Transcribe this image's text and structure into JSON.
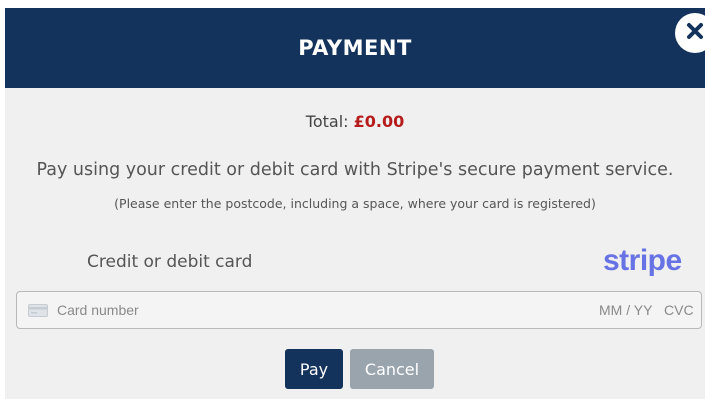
{
  "header": {
    "title": "PAYMENT",
    "close_icon": "close-icon"
  },
  "total": {
    "label": "Total:",
    "amount": "£0.00"
  },
  "info": {
    "main": "Pay using your credit or debit card with Stripe's secure payment service.",
    "note": "(Please enter the postcode, including a space, where your card is registered)"
  },
  "card": {
    "label": "Credit or debit card",
    "provider_logo": "stripe",
    "icon": "credit-card-icon",
    "number_placeholder": "Card number",
    "expiry_placeholder": "MM / YY",
    "cvc_placeholder": "CVC"
  },
  "actions": {
    "pay_label": "Pay",
    "cancel_label": "Cancel"
  },
  "colors": {
    "header_bg": "#13335c",
    "accent_amount": "#b71c1c",
    "stripe_brand": "#6772e5",
    "cancel_bg": "#9aa4ad"
  }
}
